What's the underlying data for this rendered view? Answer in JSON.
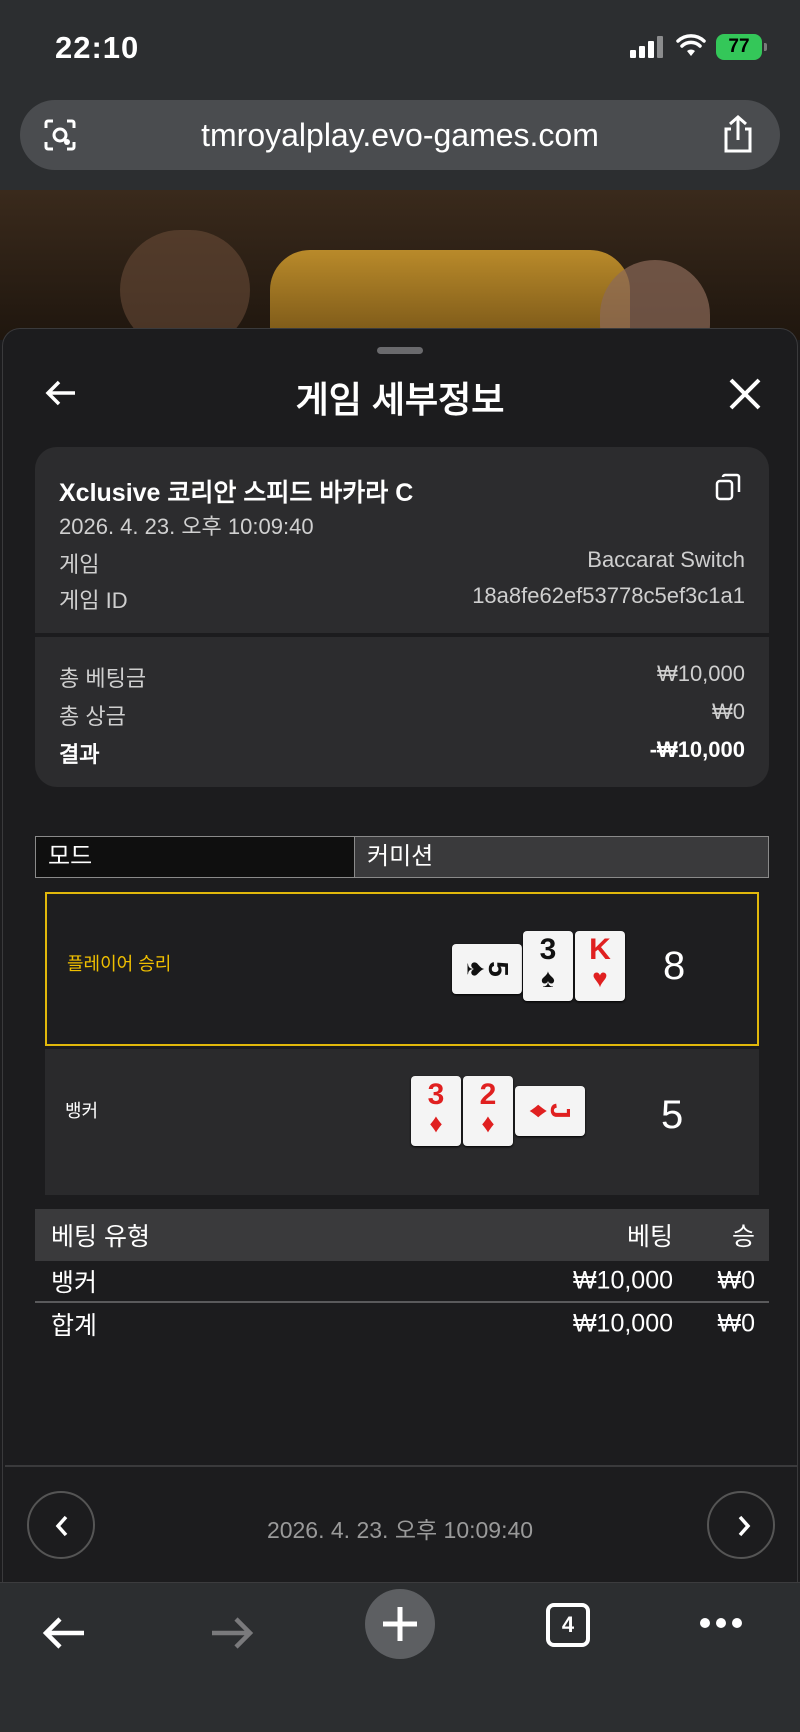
{
  "status_bar": {
    "time": "22:10",
    "battery": "77"
  },
  "browser": {
    "url": "tmroyalplay.evo-games.com",
    "tab_count": "4"
  },
  "sheet": {
    "title": "게임 세부정보",
    "game_name": "Xclusive 코리안 스피드 바카라 C",
    "date": "2026. 4. 23. 오후 10:09:40",
    "game_label": "게임",
    "game_value": "Baccarat Switch",
    "game_id_label": "게임 ID",
    "game_id_value": "18a8fe62ef53778c5ef3c1a1",
    "total_bet_label": "총 베팅금",
    "total_bet_value": "₩10,000",
    "total_win_label": "총 상금",
    "total_win_value": "₩0",
    "result_label": "결과",
    "result_value": "-₩10,000"
  },
  "tabs": {
    "mode": "모드",
    "commission": "커미션"
  },
  "hands": {
    "player": {
      "label": "플레이어 승리",
      "score": "8",
      "cards": [
        {
          "rank": "5",
          "suit": "♠",
          "color": "#111111",
          "sideways": true
        },
        {
          "rank": "3",
          "suit": "♠",
          "color": "#111111",
          "sideways": false
        },
        {
          "rank": "K",
          "suit": "♥",
          "color": "#e02020",
          "sideways": false
        }
      ]
    },
    "banker": {
      "label": "뱅커",
      "score": "5",
      "cards": [
        {
          "rank": "3",
          "suit": "♦",
          "color": "#e02020",
          "sideways": false
        },
        {
          "rank": "2",
          "suit": "♦",
          "color": "#e02020",
          "sideways": false
        },
        {
          "rank": "J",
          "suit": "♦",
          "color": "#e02020",
          "sideways": true
        }
      ]
    }
  },
  "bet_table": {
    "headers": [
      "베팅 유형",
      "베팅",
      "승"
    ],
    "rows": [
      [
        "뱅커",
        "₩10,000",
        "₩0"
      ],
      [
        "합계",
        "₩10,000",
        "₩0"
      ]
    ]
  },
  "footer": {
    "date": "2026. 4. 23. 오후 10:09:40"
  },
  "colors": {
    "accent": "#e1b80b",
    "battery": "#34c759",
    "red_suit": "#e02020"
  },
  "icons": [
    "lens-icon",
    "share-icon",
    "back-arrow-icon",
    "close-icon",
    "copy-icon",
    "chevron-left-icon",
    "chevron-right-icon",
    "plus-icon",
    "more-icon"
  ]
}
